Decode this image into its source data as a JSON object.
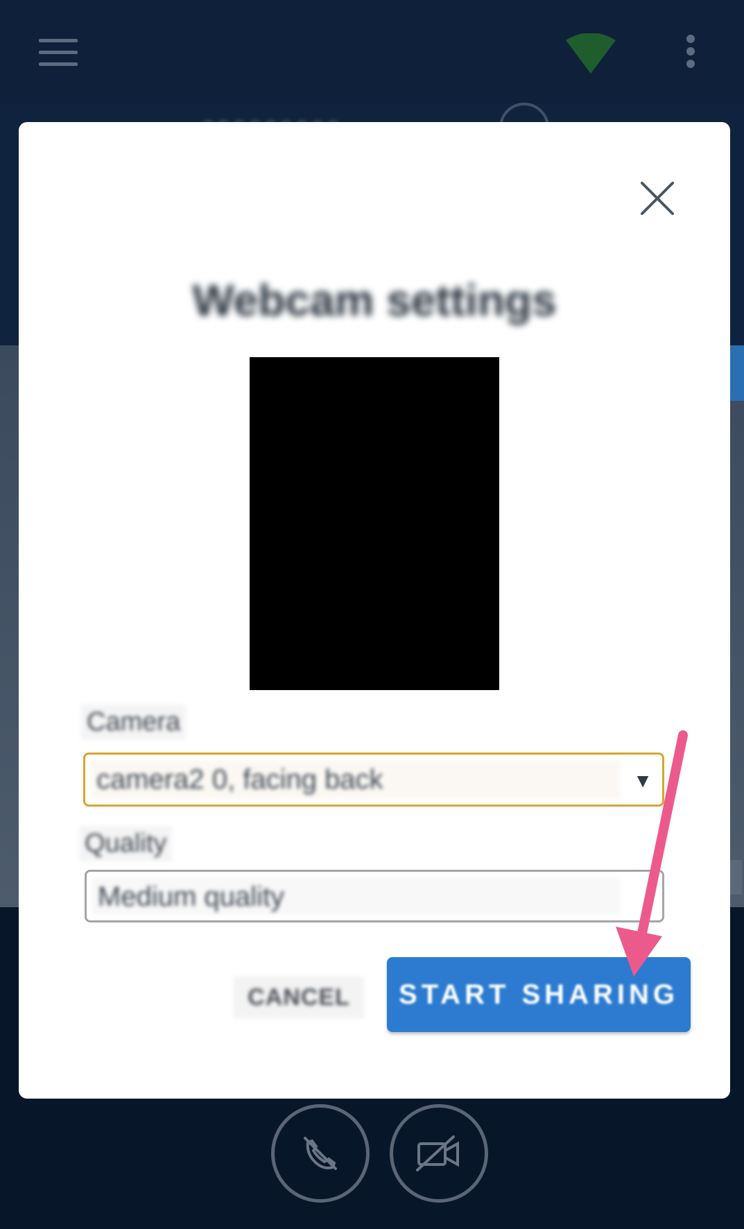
{
  "header": {
    "title": "○○○○○○○○○ ..."
  },
  "dialog": {
    "title": "Webcam settings",
    "camera_label": "Camera",
    "camera_value": "camera2 0, facing back",
    "quality_label": "Quality",
    "quality_value": "Medium quality",
    "cancel_label": "CANCEL",
    "primary_label": "START SHARING"
  },
  "colors": {
    "accent_blue": "#2c7bd0",
    "focus_border": "#d8a431",
    "signal_green": "#1f5d2d",
    "annotation_pink": "#ec5a8c"
  },
  "icons": {
    "menu": "hamburger-icon",
    "signal": "signal-strength-icon",
    "more": "kebab-menu-icon",
    "close": "close-icon",
    "dropdown": "chevron-down-icon",
    "end_call": "end-call-icon",
    "video_off": "video-off-icon"
  }
}
